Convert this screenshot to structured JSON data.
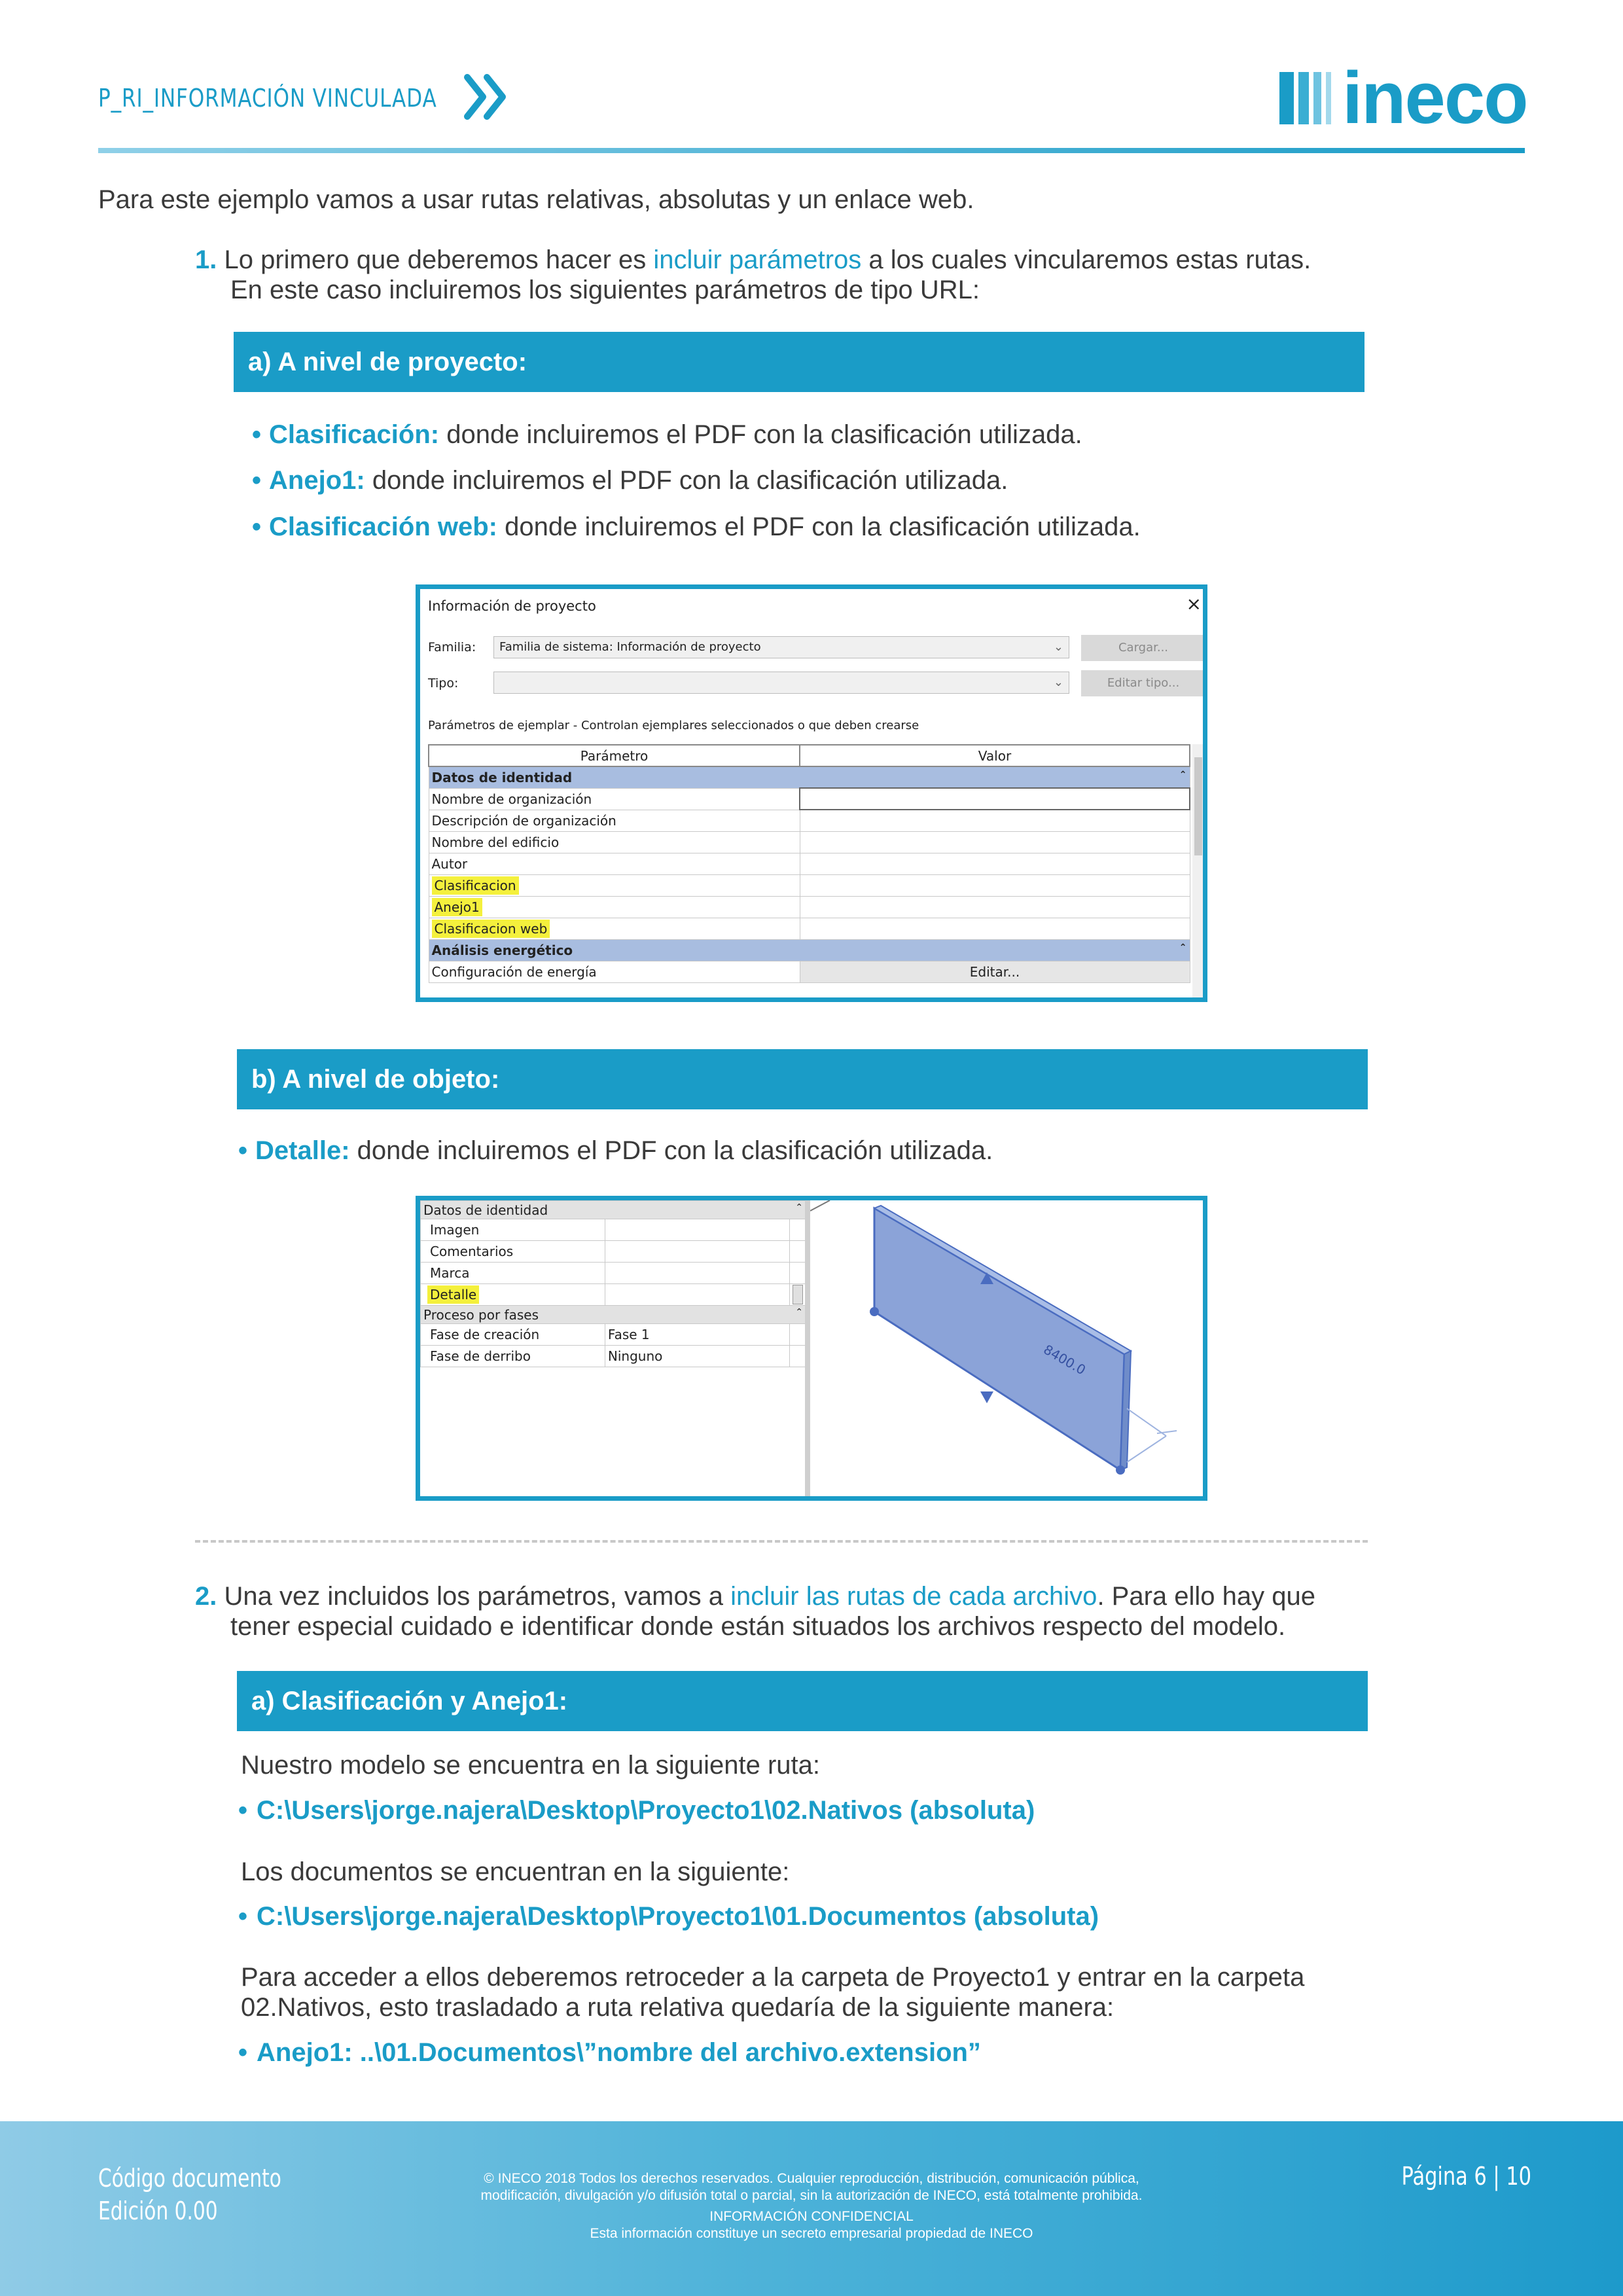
{
  "header": {
    "title": "P_RI_INFORMACIÓN VINCULADA",
    "logo_text": "ineco",
    "colors": {
      "accent": "#1a9cc7",
      "highlight": "#f4f03c"
    }
  },
  "intro": "Para este ejemplo vamos a usar rutas relativas, absolutas y un enlace web.",
  "step1": {
    "number": "1.",
    "text_a": "Lo primero que deberemos hacer es ",
    "link": "incluir parámetros",
    "text_b": " a los cuales vincularemos estas rutas.",
    "text_c": "En este caso incluiremos los siguientes parámetros de tipo URL:"
  },
  "section_a": {
    "title": "a) A nivel de proyecto:",
    "bullets": [
      {
        "label": "Clasificación:",
        "text": " donde incluiremos el PDF con la clasificación utilizada."
      },
      {
        "label": "Anejo1:",
        "text": " donde incluiremos el PDF con la clasificación utilizada."
      },
      {
        "label": "Clasificación web:",
        "text": " donde incluiremos el PDF con la clasificación utilizada."
      }
    ]
  },
  "dialog1": {
    "title": "Información de proyecto",
    "close": "×",
    "family_label": "Familia:",
    "family_value": "Familia de sistema: Información de proyecto",
    "load_button": "Cargar...",
    "type_label": "Tipo:",
    "type_value": "",
    "edit_type_button": "Editar tipo...",
    "params_caption": "Parámetros de ejemplar - Controlan ejemplares seleccionados o que deben crearse",
    "col_param": "Parámetro",
    "col_value": "Valor",
    "group1": "Datos de identidad",
    "rows": [
      "Nombre de organización",
      "Descripción de organización",
      "Nombre del edificio",
      "Autor",
      "Clasificacion",
      "Anejo1",
      "Clasificacion web"
    ],
    "group2": "Análisis energético",
    "last_row": "Configuración de energía",
    "last_value": "Editar..."
  },
  "section_b": {
    "title": "b) A nivel de objeto:",
    "bullet_label": "Detalle:",
    "bullet_text": " donde incluiremos el PDF con la clasificación utilizada."
  },
  "props2": {
    "group1": "Datos de identidad",
    "rows1": [
      {
        "name": "Imagen",
        "value": ""
      },
      {
        "name": "Comentarios",
        "value": ""
      },
      {
        "name": "Marca",
        "value": ""
      },
      {
        "name": "Detalle",
        "value": ""
      }
    ],
    "group2": "Proceso por fases",
    "rows2": [
      {
        "name": "Fase de creación",
        "value": "Fase 1"
      },
      {
        "name": "Fase de derribo",
        "value": "Ninguno"
      }
    ],
    "dimension": "8400.0"
  },
  "step2": {
    "number": "2.",
    "text_a": "Una vez incluidos los parámetros, vamos a ",
    "link": "incluir las rutas de cada archivo",
    "text_b": ". Para ello hay que",
    "text_c": "tener especial cuidado e identificar donde están situados los archivos respecto del modelo."
  },
  "section_c": {
    "title": "a) Clasificación y Anejo1:",
    "p1": "Nuestro modelo se encuentra en la siguiente ruta:",
    "path1": "C:\\Users\\jorge.najera\\Desktop\\Proyecto1\\02.Nativos (absoluta)",
    "p2": "Los documentos se encuentran en la siguiente:",
    "path2": "C:\\Users\\jorge.najera\\Desktop\\Proyecto1\\01.Documentos (absoluta)",
    "p3a": "Para acceder a ellos deberemos retroceder a la carpeta de Proyecto1 y entrar en la carpeta",
    "p3b": "02.Nativos, esto trasladado a ruta relativa quedaría de la siguiente manera:",
    "path3": "Anejo1: ..\\01.Documentos\\”nombre del archivo.extension”"
  },
  "footer": {
    "code": "Código documento",
    "edition": "Edición 0.00",
    "copy1": "© INECO 2018 Todos los derechos reservados. Cualquier reproducción, distribución, comunicación pública,",
    "copy2": "modificación, divulgación y/o difusión total o parcial, sin la autorización de INECO, está totalmente prohibida.",
    "confidential": "INFORMACIÓN CONFIDENCIAL",
    "secret": "Esta información constituye un secreto empresarial propiedad de INECO",
    "page": "Página  6 | 10"
  }
}
